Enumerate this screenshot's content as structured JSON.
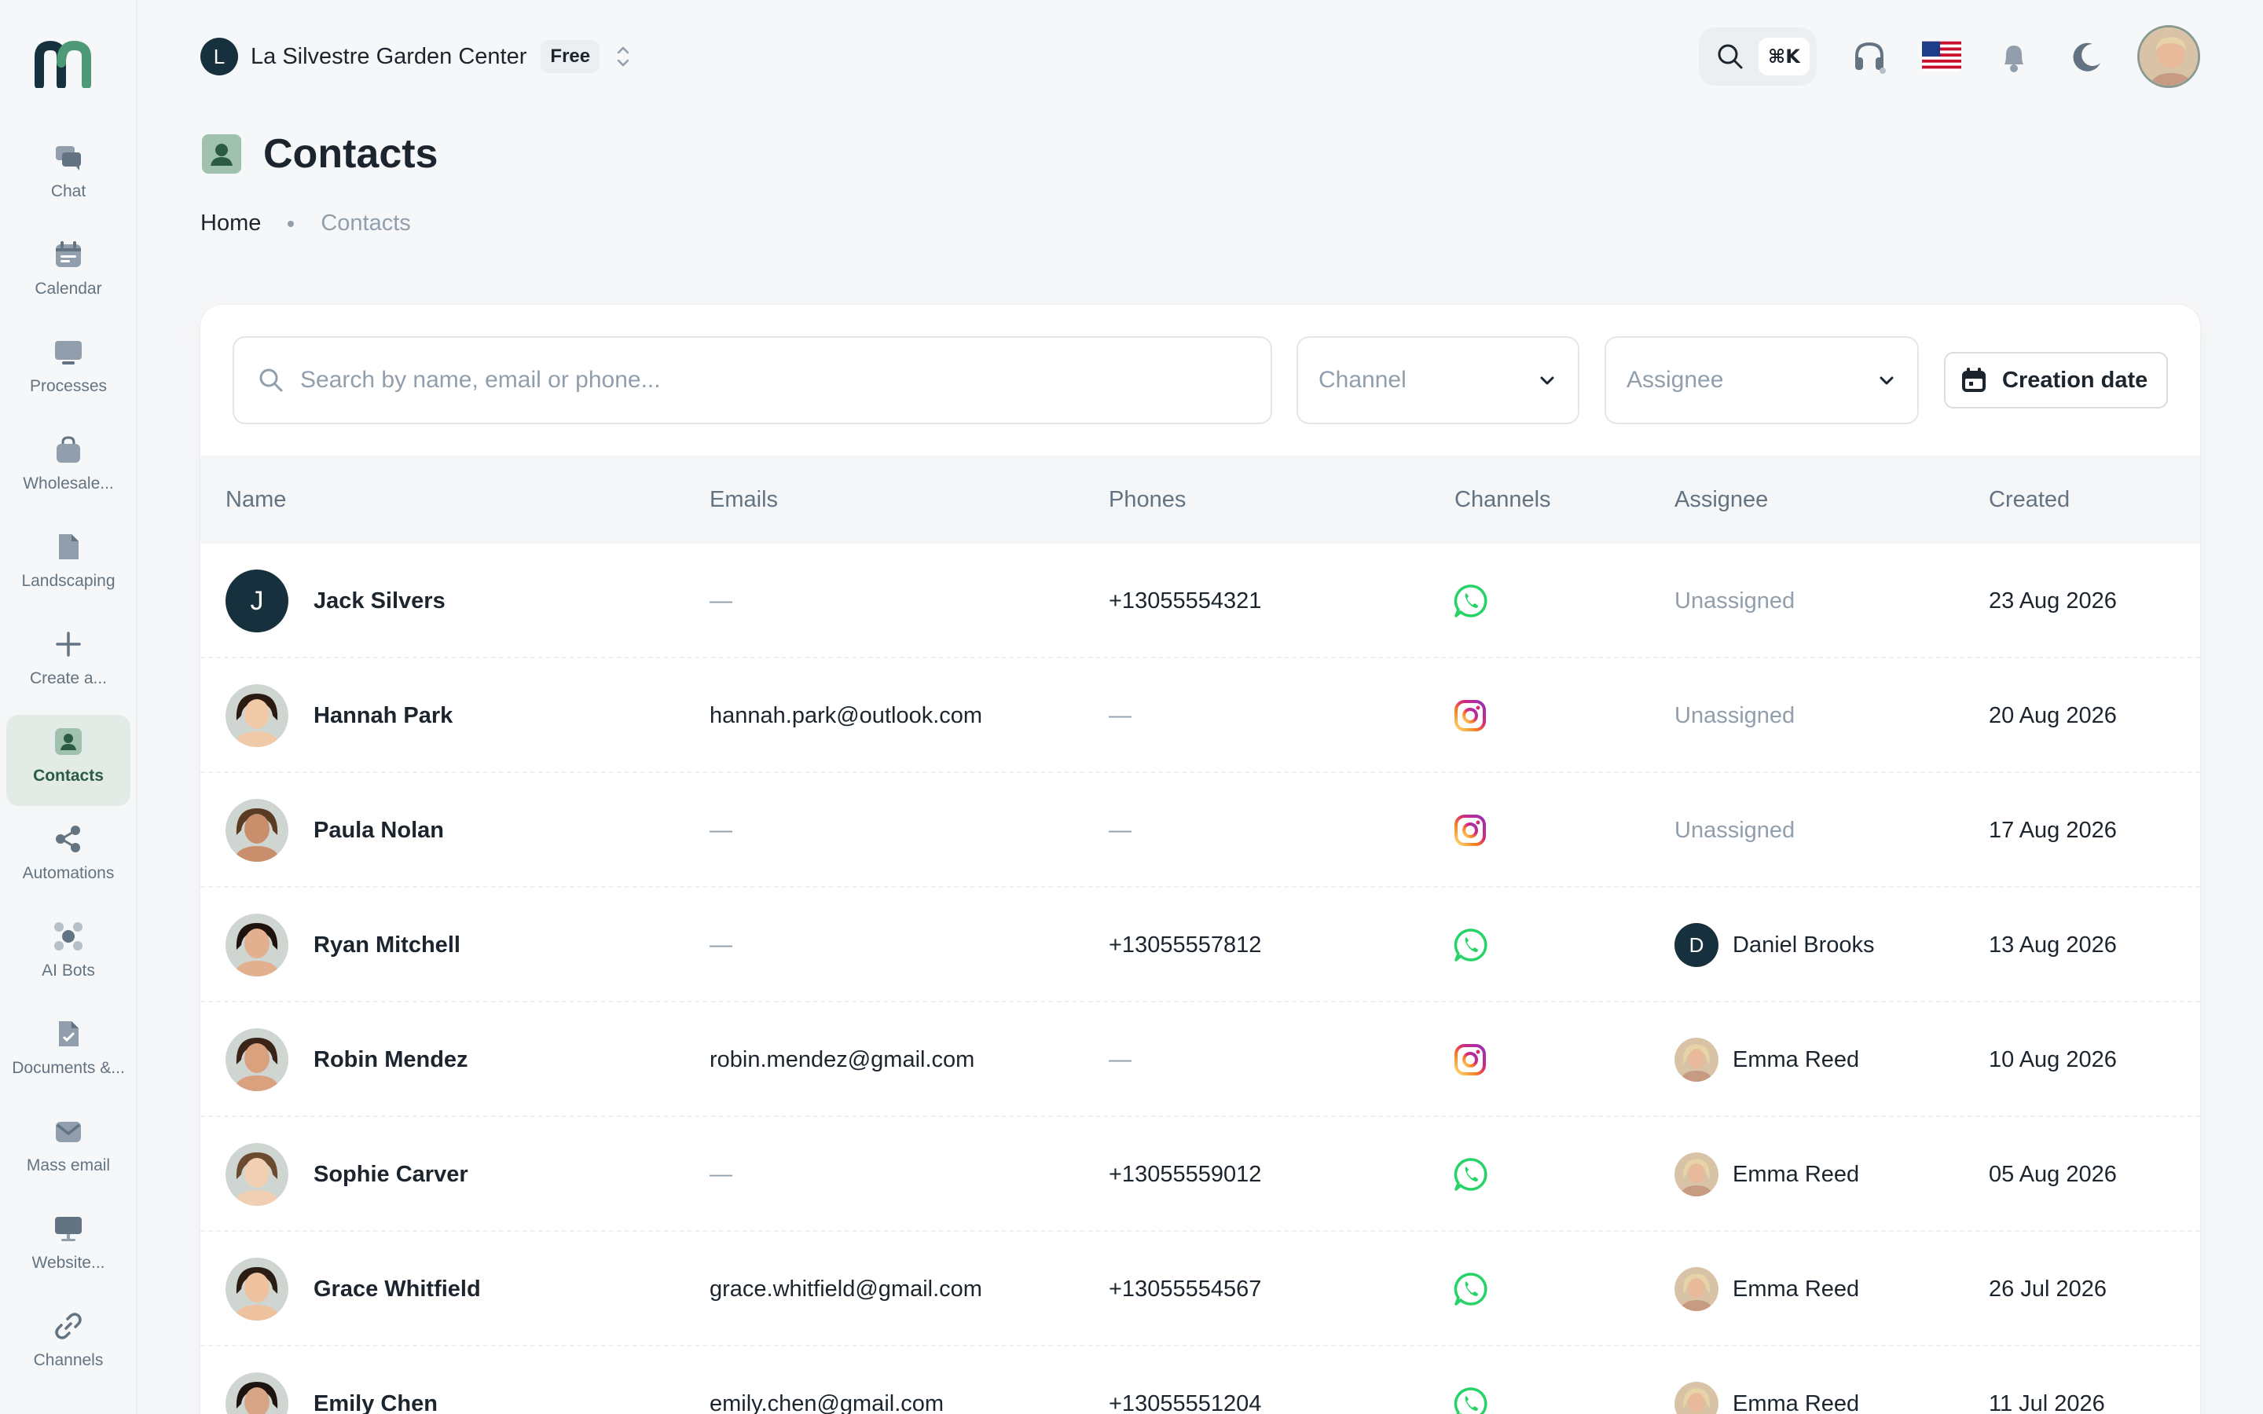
{
  "sidebar": {
    "logo_icon": "brand-logo-icon",
    "items": [
      {
        "label": "Chat",
        "icon": "chat-icon",
        "active": false
      },
      {
        "label": "Calendar",
        "icon": "calendar-icon",
        "active": false
      },
      {
        "label": "Processes",
        "icon": "processes-icon",
        "active": false
      },
      {
        "label": "Wholesale...",
        "icon": "bag-icon",
        "active": false
      },
      {
        "label": "Landscaping",
        "icon": "file-icon",
        "active": false
      },
      {
        "label": "Create a...",
        "icon": "plus-icon",
        "active": false
      },
      {
        "label": "Contacts",
        "icon": "contacts-icon",
        "active": true
      },
      {
        "label": "Automations",
        "icon": "share-icon",
        "active": false
      },
      {
        "label": "AI Bots",
        "icon": "bot-icon",
        "active": false
      },
      {
        "label": "Documents &...",
        "icon": "documents-icon",
        "active": false
      },
      {
        "label": "Mass email",
        "icon": "mail-icon",
        "active": false
      },
      {
        "label": "Website...",
        "icon": "monitor-icon",
        "active": false
      },
      {
        "label": "Channels",
        "icon": "link-icon",
        "active": false
      }
    ]
  },
  "header": {
    "org_initial": "L",
    "org_name": "La Silvestre Garden Center",
    "plan": "Free",
    "search_shortcut": "⌘K",
    "icons": [
      "search-icon",
      "headset-icon",
      "us-flag-icon",
      "bell-icon",
      "moon-icon"
    ]
  },
  "page": {
    "title": "Contacts",
    "breadcrumb": {
      "home": "Home",
      "current": "Contacts"
    }
  },
  "filters": {
    "search_placeholder": "Search by name, email or phone...",
    "channel_placeholder": "Channel",
    "assignee_placeholder": "Assignee",
    "date_button": "Creation date"
  },
  "table": {
    "columns": {
      "name": "Name",
      "emails": "Emails",
      "phones": "Phones",
      "channels": "Channels",
      "assignee": "Assignee",
      "created": "Created"
    },
    "rows": [
      {
        "name": "Jack Silvers",
        "initial": "J",
        "email": "—",
        "phone": "+13055554321",
        "channel": "whatsapp",
        "assignee": "Unassigned",
        "assignee_initial": "",
        "created": "23 Aug 2026"
      },
      {
        "name": "Hannah Park",
        "initial": "",
        "email": "hannah.park@outlook.com",
        "phone": "—",
        "channel": "instagram",
        "assignee": "Unassigned",
        "assignee_initial": "",
        "created": "20 Aug 2026"
      },
      {
        "name": "Paula Nolan",
        "initial": "",
        "email": "—",
        "phone": "—",
        "channel": "instagram",
        "assignee": "Unassigned",
        "assignee_initial": "",
        "created": "17 Aug 2026"
      },
      {
        "name": "Ryan Mitchell",
        "initial": "",
        "email": "—",
        "phone": "+13055557812",
        "channel": "whatsapp",
        "assignee": "Daniel Brooks",
        "assignee_initial": "D",
        "created": "13 Aug 2026"
      },
      {
        "name": "Robin Mendez",
        "initial": "",
        "email": "robin.mendez@gmail.com",
        "phone": "—",
        "channel": "instagram",
        "assignee": "Emma Reed",
        "assignee_initial": "",
        "created": "10 Aug 2026"
      },
      {
        "name": "Sophie Carver",
        "initial": "",
        "email": "—",
        "phone": "+13055559012",
        "channel": "whatsapp",
        "assignee": "Emma Reed",
        "assignee_initial": "",
        "created": "05 Aug 2026"
      },
      {
        "name": "Grace Whitfield",
        "initial": "",
        "email": "grace.whitfield@gmail.com",
        "phone": "+13055554567",
        "channel": "whatsapp",
        "assignee": "Emma Reed",
        "assignee_initial": "",
        "created": "26 Jul 2026"
      },
      {
        "name": "Emily Chen",
        "initial": "",
        "email": "emily.chen@gmail.com",
        "phone": "+13055551204",
        "channel": "whatsapp",
        "assignee": "Emma Reed",
        "assignee_initial": "",
        "created": "11 Jul 2026"
      }
    ]
  },
  "colors": {
    "accent": "#2b5a45",
    "avatar_dark": "#17303d",
    "whatsapp": "#25D366",
    "instagram": "#E1306C"
  }
}
